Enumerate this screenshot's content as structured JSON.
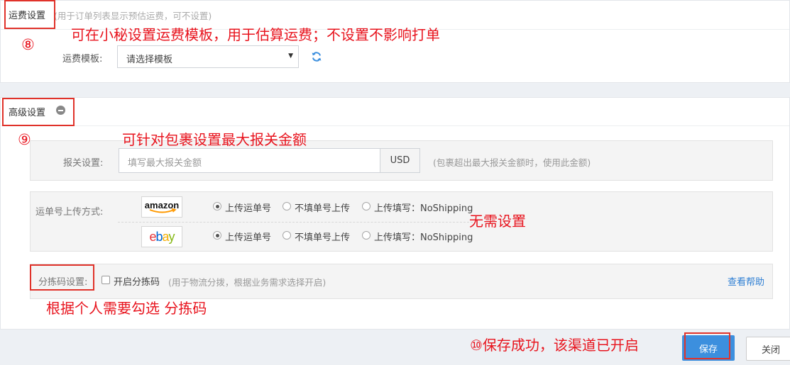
{
  "shipping": {
    "title": "运费设置",
    "hint": "(用于订单列表显示预估运费，可不设置)",
    "template_label": "运费模板:",
    "template_value": "请选择模板"
  },
  "advanced": {
    "title": "高级设置",
    "customs_label": "报关设置:",
    "customs_placeholder": "填写最大报关金额",
    "customs_currency": "USD",
    "customs_hint": "(包裹超出最大报关金额时，使用此金额)",
    "tracking_label": "运单号上传方式:",
    "amazon_logo": "amazon",
    "ebay_logo_letters": [
      "e",
      "b",
      "a",
      "y"
    ],
    "amazon_options": [
      "上传运单号",
      "不填单号上传",
      "上传填写：NoShipping"
    ],
    "amazon_selected": 0,
    "ebay_options": [
      "上传运单号",
      "不填单号上传",
      "上传填写：NoShipping"
    ],
    "ebay_selected": 0,
    "sort_label": "分拣码设置:",
    "sort_checkbox_label": "开启分拣码",
    "sort_checked": false,
    "sort_hint": "(用于物流分拨，根据业务需求选择开启)",
    "help_link": "查看帮助"
  },
  "footer": {
    "save": "保存",
    "close": "关闭"
  },
  "annotations": {
    "step8": "⑧",
    "note8": "可在小秘设置运费模板，用于估算运费；不设置不影响打单",
    "step9": "⑨",
    "note9": "可针对包裹设置最大报关金额",
    "note_none": "无需设置",
    "note_sort": "根据个人需要勾选 分拣码",
    "note10": "⑩保存成功，该渠道已开启"
  },
  "colors": {
    "accent": "#3c8fde",
    "annotation_red": "#e8141e",
    "link": "#2f7fd3",
    "ebay": [
      "#e53238",
      "#0064d2",
      "#f5af02",
      "#86b817"
    ]
  }
}
